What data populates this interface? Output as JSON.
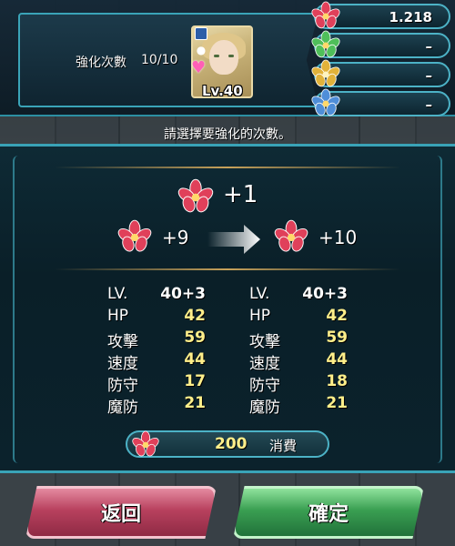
{
  "header": {
    "merge_label": "強化次數",
    "merge_count": "10/10",
    "level": "Lv.40"
  },
  "resources": [
    {
      "flower": "red",
      "color": "#e0405a",
      "value": "1.218"
    },
    {
      "flower": "green",
      "color": "#4fbf5a",
      "value": "–"
    },
    {
      "flower": "gold",
      "color": "#e2b23a",
      "value": "–"
    },
    {
      "flower": "blue",
      "color": "#4f8ed8",
      "value": "–"
    }
  ],
  "instruction": "請選擇要強化的次數。",
  "panel": {
    "plus": "+1",
    "before": "+9",
    "after": "+10",
    "stats_before": [
      {
        "name": "LV.",
        "value": "40+3"
      },
      {
        "name": "HP",
        "value": "42"
      },
      {
        "name": "攻擊",
        "value": "59"
      },
      {
        "name": "速度",
        "value": "44"
      },
      {
        "name": "防守",
        "value": "17"
      },
      {
        "name": "魔防",
        "value": "21"
      }
    ],
    "stats_after": [
      {
        "name": "LV.",
        "value": "40+3"
      },
      {
        "name": "HP",
        "value": "42"
      },
      {
        "name": "攻擊",
        "value": "59"
      },
      {
        "name": "速度",
        "value": "44"
      },
      {
        "name": "防守",
        "value": "18"
      },
      {
        "name": "魔防",
        "value": "21"
      }
    ],
    "cost_value": "200",
    "cost_label": "消費"
  },
  "buttons": {
    "back": "返回",
    "confirm": "確定"
  },
  "icons": {
    "flower": "dew-flower-icon",
    "arrow": "arrow-right-icon",
    "heart": "heart-icon",
    "book": "book-icon",
    "people": "people-icon"
  }
}
